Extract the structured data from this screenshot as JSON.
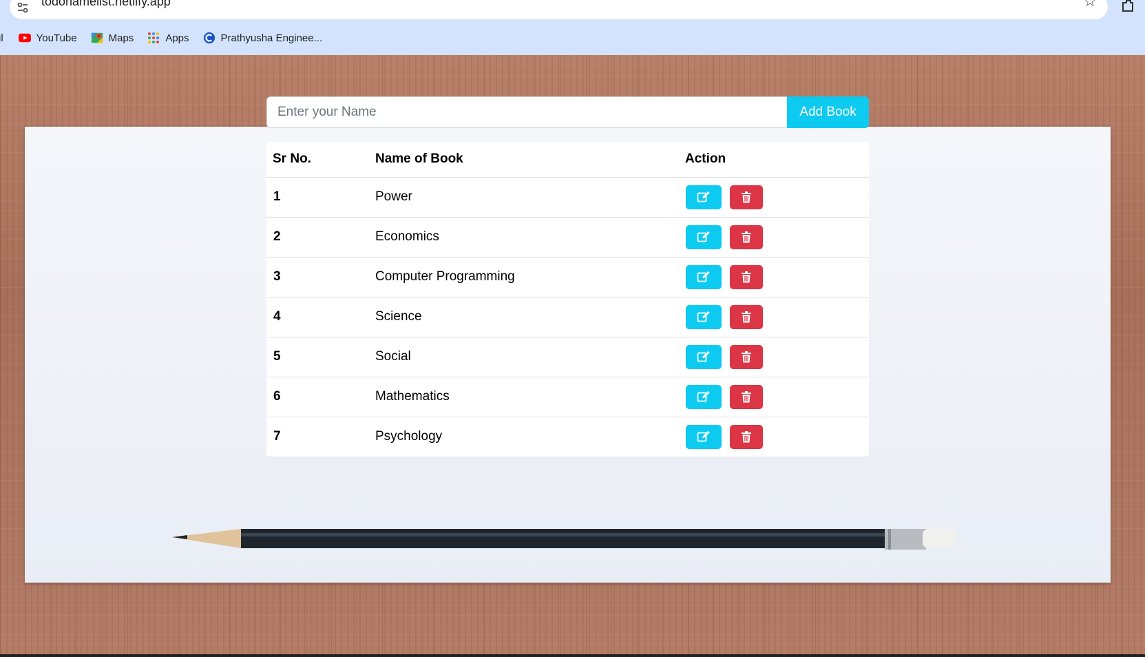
{
  "browser": {
    "url": "todonamelist.netlify.app",
    "bookmarks": [
      {
        "label": "il",
        "icon": "gmail-icon"
      },
      {
        "label": "YouTube",
        "icon": "youtube-icon"
      },
      {
        "label": "Maps",
        "icon": "maps-icon"
      },
      {
        "label": "Apps",
        "icon": "apps-grid-icon"
      },
      {
        "label": "Prathyusha Enginee...",
        "icon": "college-logo-icon"
      }
    ]
  },
  "form": {
    "placeholder": "Enter your Name",
    "value": "",
    "add_label": "Add Book"
  },
  "table": {
    "headers": {
      "sr": "Sr No.",
      "name": "Name of Book",
      "action": "Action"
    },
    "rows": [
      {
        "sr": "1",
        "name": "Power"
      },
      {
        "sr": "2",
        "name": "Economics"
      },
      {
        "sr": "3",
        "name": "Computer Programming"
      },
      {
        "sr": "4",
        "name": "Science"
      },
      {
        "sr": "5",
        "name": "Social"
      },
      {
        "sr": "6",
        "name": "Mathematics"
      },
      {
        "sr": "7",
        "name": "Psychology"
      }
    ]
  },
  "colors": {
    "edit_button": "#0dcaf0",
    "delete_button": "#dc3545",
    "add_button": "#0dcaf0",
    "browser_chrome": "#d3e3fd"
  }
}
